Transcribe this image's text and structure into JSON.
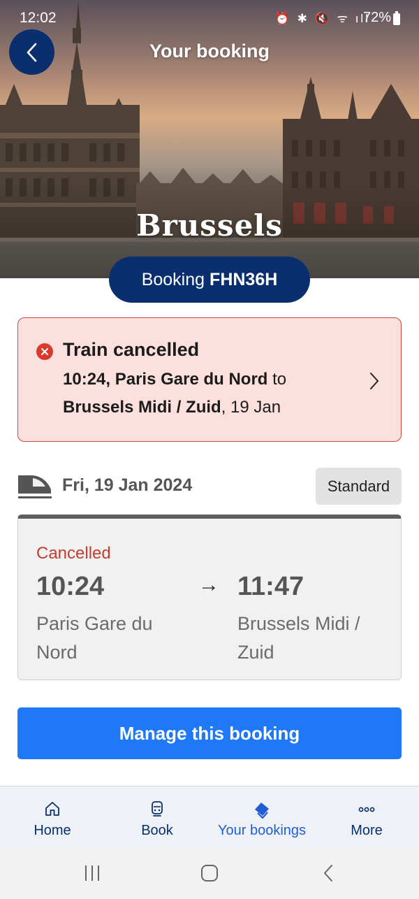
{
  "status_bar": {
    "time": "12:02",
    "battery": "72%",
    "icons": "⏰ ✱ 🔇 ᯤ ıll"
  },
  "header": {
    "title": "Your booking",
    "city": "Brussels"
  },
  "booking": {
    "prefix": "Booking",
    "reference": "FHN36H"
  },
  "alert": {
    "title": "Train cancelled",
    "dep_time_station": "10:24, Paris Gare du Nord",
    "to_word": " to",
    "arr_station": "Brussels Midi / Zuid",
    "date_suffix": ", 19 Jan"
  },
  "journey": {
    "date": "Fri, 19 Jan 2024",
    "class": "Standard",
    "status": "Cancelled",
    "departure_time": "10:24",
    "arrival_time": "11:47",
    "arrow": "→",
    "departure_station": "Paris Gare du Nord",
    "arrival_station": "Brussels Midi / Zuid"
  },
  "manage_button": "Manage this booking",
  "bottom_nav": [
    {
      "label": "Home",
      "icon": "home-icon"
    },
    {
      "label": "Book",
      "icon": "train-front-icon"
    },
    {
      "label": "Your bookings",
      "icon": "tickets-icon",
      "active": true
    },
    {
      "label": "More",
      "icon": "more-dots-icon"
    }
  ],
  "colors": {
    "navy": "#0a2f6e",
    "primary_blue": "#1f78f5",
    "alert_bg": "#fbe0de",
    "alert_border": "#c64a3e",
    "cancelled_red": "#c43d2f",
    "active_nav": "#1f5fd6"
  }
}
